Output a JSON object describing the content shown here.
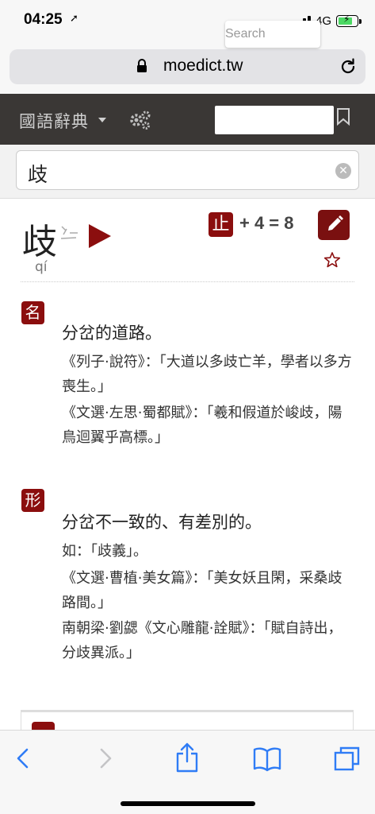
{
  "status": {
    "time": "04:25",
    "network": "4G"
  },
  "browser": {
    "url": "moedict.tw"
  },
  "nav": {
    "title": "國語辭典",
    "search_placeholder": "Search"
  },
  "query": {
    "value": "歧"
  },
  "entry": {
    "character": "歧",
    "pinyin": "qí",
    "radical": "止",
    "stroke_info": "+ 4  =  8",
    "senses": [
      {
        "pos": "名",
        "definition": "分岔的道路。",
        "examples": [
          "《列子·說符》：「大道以多歧亡羊，學者以多方喪生。」",
          "《文選·左思·蜀都賦》：「羲和假道於峻歧，陽鳥迴翼乎高標。」"
        ]
      },
      {
        "pos": "形",
        "definition": "分岔不一致的、有差別的。",
        "examples": [
          "如：「歧義」。",
          "《文選·曹植·美女篇》：「美女妖且閑，采桑歧路間。」",
          "南朝梁·劉勰《文心雕龍·詮賦》：「賦自詩出，分歧異派。」"
        ]
      }
    ]
  },
  "colors": {
    "accent": "#8b0e0e",
    "nav_bg": "#3a3735",
    "ios_blue": "#2f7cf6"
  }
}
